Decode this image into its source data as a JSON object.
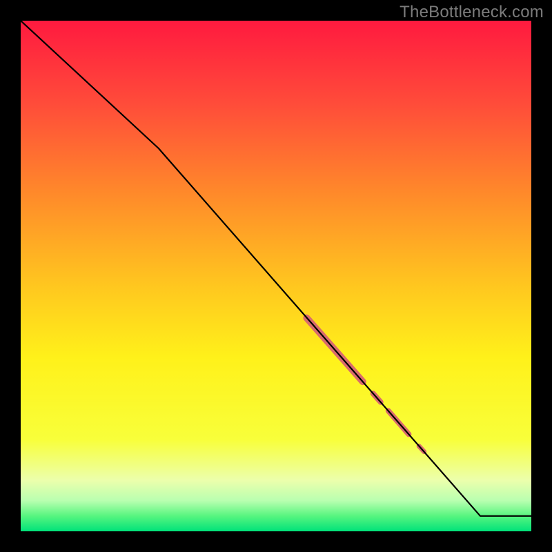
{
  "watermark": "TheBottleneck.com",
  "colors": {
    "frame": "#000000",
    "line": "#000000",
    "highlight": "#d96c6c",
    "gradient_stops": [
      {
        "pct": 0,
        "color": "#ff1a3f"
      },
      {
        "pct": 16,
        "color": "#ff4b3a"
      },
      {
        "pct": 34,
        "color": "#ff8a2a"
      },
      {
        "pct": 52,
        "color": "#ffc71f"
      },
      {
        "pct": 66,
        "color": "#fff11a"
      },
      {
        "pct": 82,
        "color": "#f8ff3a"
      },
      {
        "pct": 90,
        "color": "#ecffac"
      },
      {
        "pct": 94,
        "color": "#b9ffb0"
      },
      {
        "pct": 97,
        "color": "#57f57f"
      },
      {
        "pct": 100,
        "color": "#00e27a"
      }
    ]
  },
  "chart_data": {
    "type": "line",
    "title": "",
    "xlabel": "",
    "ylabel": "",
    "xlim": [
      0,
      100
    ],
    "ylim": [
      0,
      100
    ],
    "series": [
      {
        "name": "curve",
        "x": [
          0,
          27,
          90,
          100
        ],
        "y": [
          100,
          75,
          3,
          3
        ]
      }
    ],
    "highlights": [
      {
        "x0": 56,
        "y0": 41.8,
        "x1": 67,
        "y1": 29.3,
        "width": 10
      },
      {
        "x0": 69,
        "y0": 27.0,
        "x1": 70.5,
        "y1": 25.3,
        "width": 8
      },
      {
        "x0": 72,
        "y0": 23.6,
        "x1": 76,
        "y1": 19.0,
        "width": 8
      },
      {
        "x0": 78,
        "y0": 16.7,
        "x1": 79,
        "y1": 15.6,
        "width": 7
      }
    ]
  }
}
